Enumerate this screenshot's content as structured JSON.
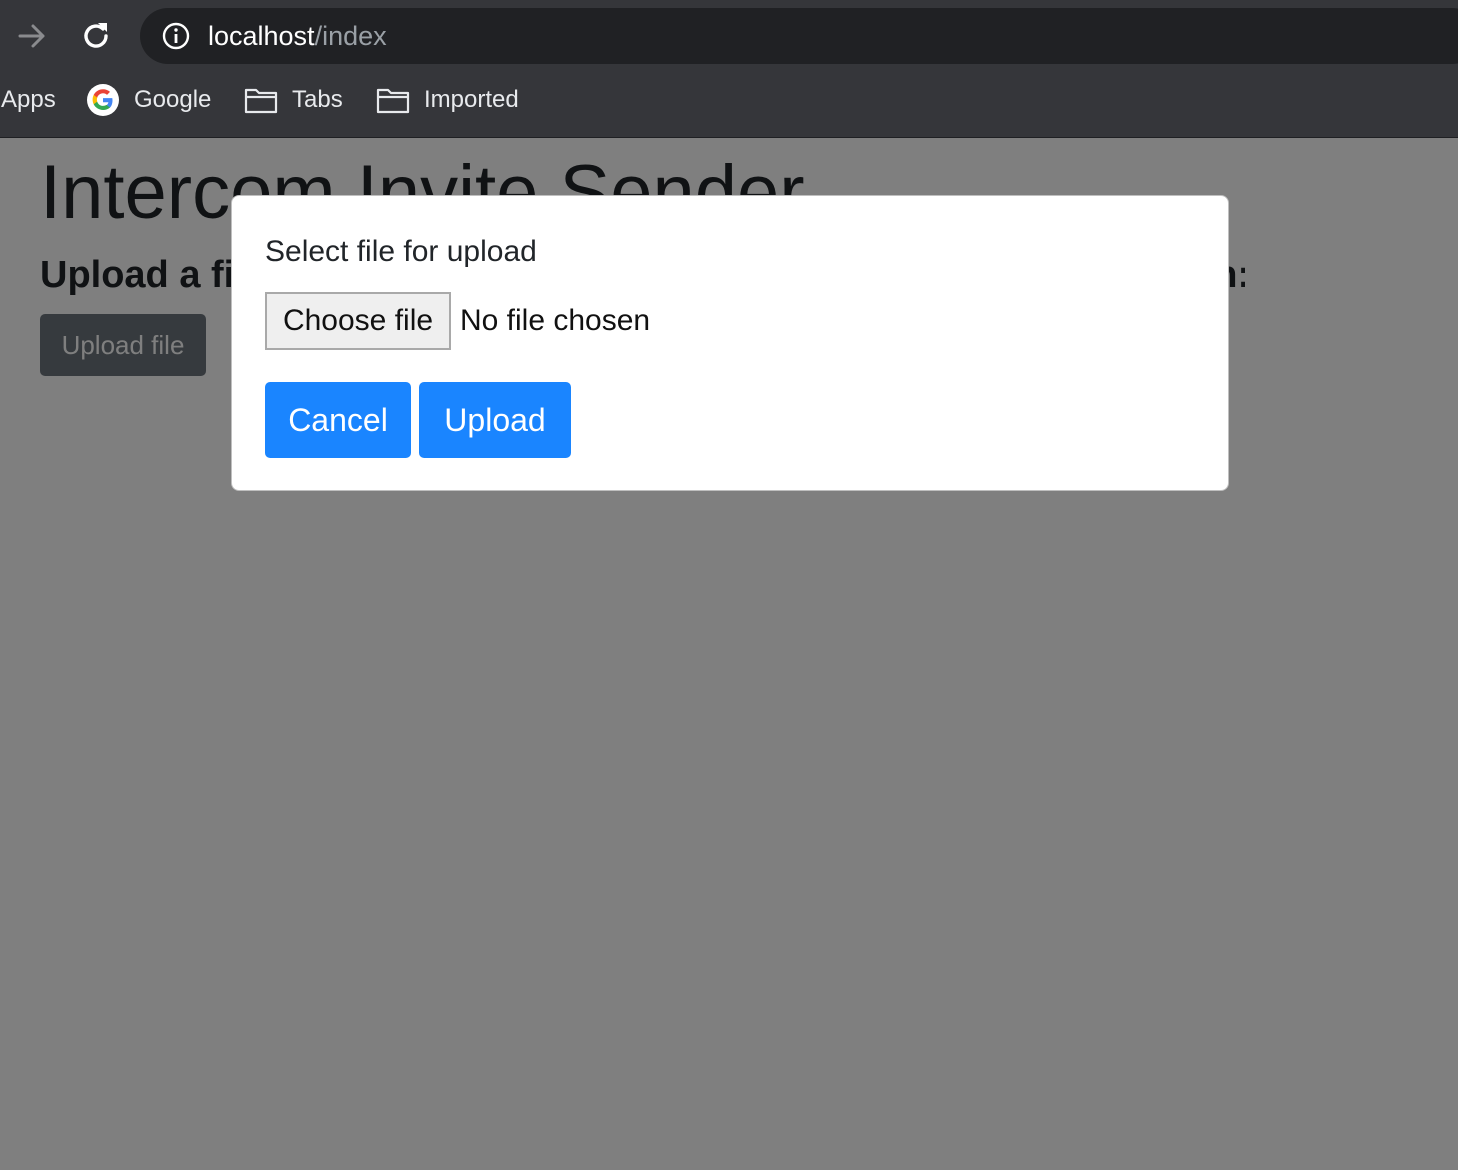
{
  "browser": {
    "url_host": "localhost",
    "url_path": "/index",
    "bookmarks": [
      {
        "label": "Apps",
        "icon": "apps-icon"
      },
      {
        "label": "Google",
        "icon": "google-icon"
      },
      {
        "label": "Tabs",
        "icon": "folder-icon"
      },
      {
        "label": "Imported",
        "icon": "folder-icon"
      }
    ]
  },
  "page": {
    "title": "Intercom Invite Sender",
    "subtitle_visible_left": "Upload a fi",
    "subtitle_visible_right": "n:",
    "upload_button": "Upload file"
  },
  "modal": {
    "title": "Select file for upload",
    "choose_file": "Choose file",
    "file_status": "No file chosen",
    "cancel_label": "Cancel",
    "upload_label": "Upload"
  },
  "colors": {
    "primary": "#1a85ff",
    "secondary": "#6c757d",
    "chrome": "#35363a",
    "omnibox": "#202124"
  }
}
